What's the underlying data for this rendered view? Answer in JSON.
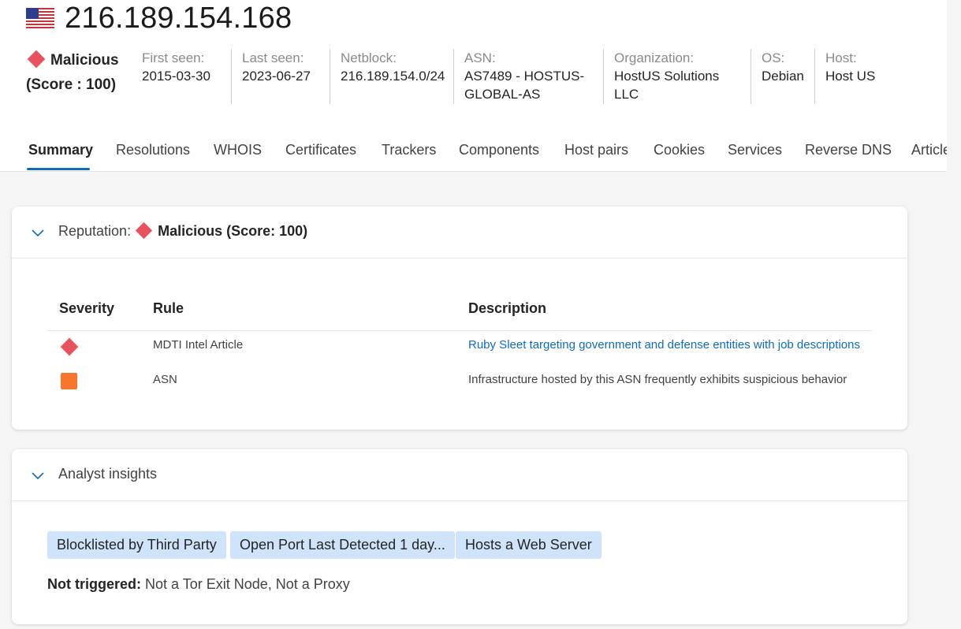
{
  "header": {
    "ip": "216.189.154.168",
    "flag_icon": "us-flag-icon",
    "verdict": "Malicious",
    "score": "(Score : 100)",
    "verdict_color": "#e8515e"
  },
  "meta": [
    {
      "label": "First seen:",
      "value": "2015-03-30"
    },
    {
      "label": "Last seen:",
      "value": "2023-06-27"
    },
    {
      "label": "Netblock:",
      "value": "216.189.154.0/24"
    },
    {
      "label": "ASN:",
      "value": "AS7489 - HOSTUS-GLOBAL-AS"
    },
    {
      "label": "Organization:",
      "value": "HostUS Solutions LLC"
    },
    {
      "label": "OS:",
      "value": "Debian"
    },
    {
      "label": "Host:",
      "value": "Host US"
    }
  ],
  "tabs": [
    "Summary",
    "Resolutions",
    "WHOIS",
    "Certificates",
    "Trackers",
    "Components",
    "Host pairs",
    "Cookies",
    "Services",
    "Reverse DNS",
    "Articles"
  ],
  "active_tab": "Summary",
  "reputation": {
    "label": "Reputation:",
    "verdict": "Malicious (Score: 100)",
    "columns": [
      "Severity",
      "Rule",
      "Description"
    ],
    "rows": [
      {
        "severity": "malicious",
        "rule": "MDTI Intel Article",
        "description": "Ruby Sleet targeting government and defense entities with job descriptions",
        "is_link": true
      },
      {
        "severity": "suspicious",
        "rule": "ASN",
        "description": "Infrastructure hosted by this ASN frequently exhibits suspicious behavior",
        "is_link": false
      }
    ]
  },
  "insights": {
    "title": "Analyst insights",
    "chips": [
      "Blocklisted by Third Party",
      "Open Port Last Detected 1 day...",
      "Hosts a Web Server"
    ],
    "not_triggered_label": "Not triggered:",
    "not_triggered_value": "Not a Tor Exit Node, Not a Proxy"
  },
  "colors": {
    "accent": "#0f6cbd",
    "malicious": "#e8515e",
    "suspicious": "#f7752c",
    "chip_bg": "#cfe4fa"
  }
}
